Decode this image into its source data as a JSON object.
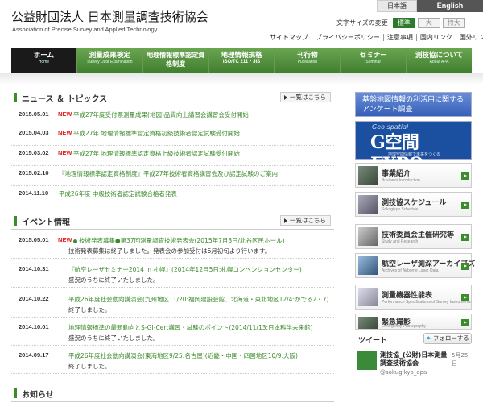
{
  "header": {
    "title": "公益財団法人 日本測量調査技術協会",
    "subtitle": "Association of Precise Survey and Applied Technology",
    "lang_jp": "日本語",
    "lang_en": "English",
    "fontsize_label": "文字サイズの変更",
    "fontsize_options": [
      "標準",
      "大",
      "特大"
    ],
    "util_links": [
      "サイトマップ",
      "プライバシーポリシー",
      "注意事項",
      "国内リンク",
      "国外リンク"
    ]
  },
  "nav": [
    {
      "main": "ホーム",
      "sub": "Home"
    },
    {
      "main": "測量成果検定",
      "sub": "Survey Data Examination"
    },
    {
      "main": "地理情報標準認定資格制度",
      "sub": ""
    },
    {
      "main": "地理情報規格",
      "sub": "ISO/TC 211・JIS"
    },
    {
      "main": "刊行物",
      "sub": "Publication"
    },
    {
      "main": "セミナー",
      "sub": "Seminar"
    },
    {
      "main": "測技協について",
      "sub": "About APA"
    }
  ],
  "news": {
    "title": "ニュース ＆ トピックス",
    "more": "一覧はこちら",
    "items": [
      {
        "date": "2015.05.01",
        "new": "NEW",
        "text": "平成27年度受付票測量成果(地図)品質向上講習会講習会受付開始"
      },
      {
        "date": "2015.04.03",
        "new": "NEW",
        "text": "平成27年 地理情報標準認定資格初級技術者認定試験受付開始"
      },
      {
        "date": "2015.03.02",
        "new": "NEW",
        "text": "平成27年 地理情報標準認定資格上級技術者認定試験受付開始"
      },
      {
        "date": "2015.02.10",
        "new": "",
        "text": "『地理情報標準認定資格制度』平成27年技術者資格講習会及び認定試験のご案内"
      },
      {
        "date": "2014.11.10",
        "new": "",
        "text": "平成26年度 中級技術者認定試験合格者発表"
      }
    ]
  },
  "events": {
    "title": "イベント情報",
    "more": "一覧はこちら",
    "items": [
      {
        "date": "2015.05.01",
        "new": "NEW",
        "text": "技術発表募集●第37回測量調査技術発表会(2015年7月8日/北谷区民ホール)",
        "desc": "技術発表募集は終了しました。発表会の参加受付は6月初旬より行います。"
      },
      {
        "date": "2014.10.31",
        "new": "",
        "text": "『航空レーザセミナー2014 in 札幌』(2014年12月5日:札幌コンベンションセンター)",
        "desc": "盛況のうちに終了いたしました。"
      },
      {
        "date": "2014.10.22",
        "new": "",
        "text": "平成26年度社会動向講演会(九州地区11/20:福岡建設会館、北海道・東北地区12/4:かでる2・7)",
        "desc": "終了しました。"
      },
      {
        "date": "2014.10.01",
        "new": "",
        "text": "地理情報標準の最新動向とS-GI-Cert講習・試験のポイント(2014/11/13:日本科学未来館)",
        "desc": "盛況のうちに終了いたしました。"
      },
      {
        "date": "2014.09.17",
        "new": "",
        "text": "平成26年度社会動向講演会(東海地区9/25:名古屋)(近畿・中国・四国地区10/9:大阪)",
        "desc": "終了しました。"
      }
    ]
  },
  "notices": {
    "title": "お知らせ"
  },
  "sidebar": {
    "survey_banner": "基盤地図情報の利活用に関するアンケート調査",
    "geo_banner": {
      "top": "Geo spatial",
      "main": "G空間EXPO",
      "sub": "地理空間情報で未来をつくる"
    },
    "items": [
      {
        "main": "事業紹介",
        "sub": "Business Introduction"
      },
      {
        "main": "測技協スケジュール",
        "sub": "Sokugikyo Schedule"
      },
      {
        "main": "技術委員会主催研究等",
        "sub": "Study and Research"
      },
      {
        "main": "航空レーザ測深アーカイブズ",
        "sub": "Archives of Airborne Laser Data"
      },
      {
        "main": "測量機器性能表",
        "sub": "Performance Specifications of Survey Instruments"
      },
      {
        "main": "緊急撮影",
        "sub": "Emergency Photography"
      }
    ]
  },
  "twitter": {
    "title": "ツイート",
    "follow": "フォローする",
    "name": "測技協_(公財)日本測量調査技術協会",
    "handle": "@sokugikyo_apa",
    "date": "5月25日"
  },
  "colors": {
    "accent": "#3c8c2e",
    "new_red": "#e02020",
    "link_green": "#3a8a2a"
  }
}
